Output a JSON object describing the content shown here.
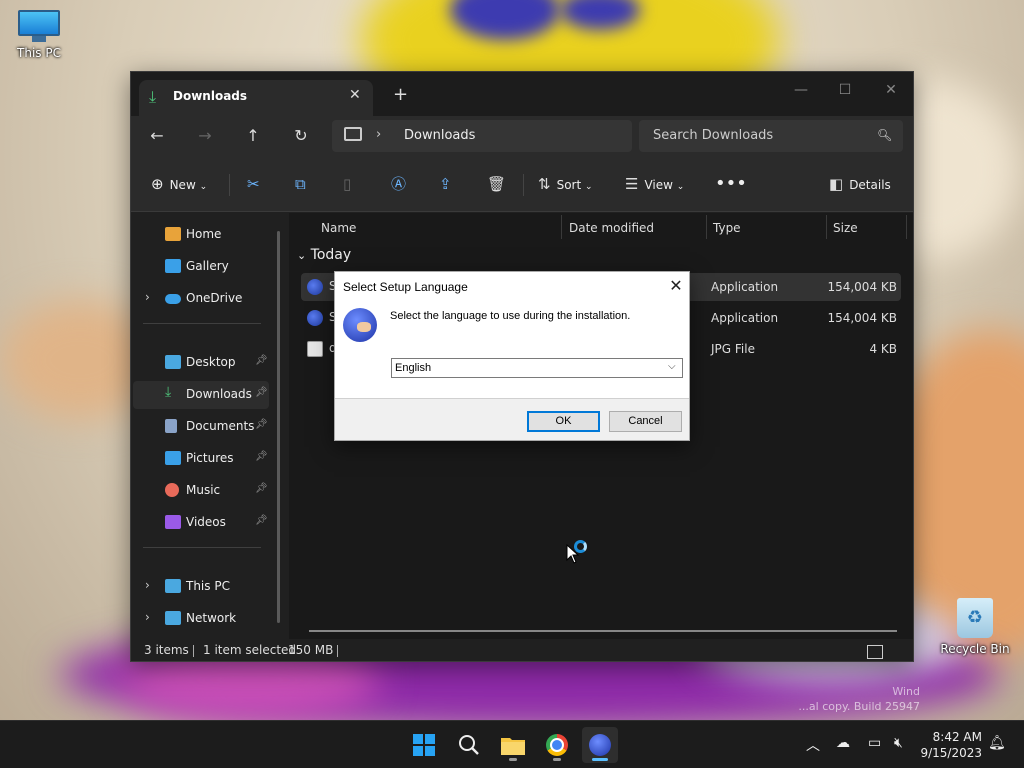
{
  "desktop": {
    "icons": [
      {
        "label": "This PC"
      },
      {
        "label": "Recycle Bin"
      }
    ],
    "watermark": [
      "Wind",
      "...al copy. Build 25947"
    ]
  },
  "explorer": {
    "tab_title": "Downloads",
    "new_tab_symbol": "+",
    "address": {
      "location": "Downloads"
    },
    "search_placeholder": "Search Downloads",
    "commands": {
      "new": "New",
      "sort": "Sort",
      "view": "View",
      "details": "Details"
    },
    "sidebar": [
      {
        "label": "Home",
        "icon": "home-icon",
        "color": "#e8a33a"
      },
      {
        "label": "Gallery",
        "icon": "gallery-icon",
        "color": "#3aa0e8"
      },
      {
        "label": "OneDrive",
        "icon": "cloud-icon",
        "color": "#3aa0e8"
      },
      {
        "label": "Desktop",
        "icon": "desktop-icon",
        "color": "#4aa8e0"
      },
      {
        "label": "Downloads",
        "icon": "download-icon",
        "color": "#4ec27a"
      },
      {
        "label": "Documents",
        "icon": "document-icon",
        "color": "#8aa3c8"
      },
      {
        "label": "Pictures",
        "icon": "pictures-icon",
        "color": "#3aa0e8"
      },
      {
        "label": "Music",
        "icon": "music-icon",
        "color": "#e86a5a"
      },
      {
        "label": "Videos",
        "icon": "video-icon",
        "color": "#9a5ae8"
      },
      {
        "label": "This PC",
        "icon": "computer-icon",
        "color": "#4aa8e0"
      },
      {
        "label": "Network",
        "icon": "network-icon",
        "color": "#4aa8e0"
      }
    ],
    "columns": {
      "name": "Name",
      "date": "Date modified",
      "type": "Type",
      "size": "Size"
    },
    "group": "Today",
    "files": [
      {
        "name": "S",
        "type": "Application",
        "size": "154,004 KB"
      },
      {
        "name": "S",
        "type": "Application",
        "size": "154,004 KB"
      },
      {
        "name": "d",
        "type": "JPG File",
        "size": "4 KB"
      }
    ],
    "status": {
      "count": "3 items",
      "selected": "1 item selected",
      "size": "150 MB"
    }
  },
  "dialog": {
    "title": "Select Setup Language",
    "message": "Select the language to use during the installation.",
    "selected_language": "English",
    "ok": "OK",
    "cancel": "Cancel"
  },
  "taskbar": {
    "time": "8:42 AM",
    "date": "9/15/2023"
  },
  "colors": {
    "accent": "#0078d7",
    "downloads_green": "#4ec27a"
  }
}
